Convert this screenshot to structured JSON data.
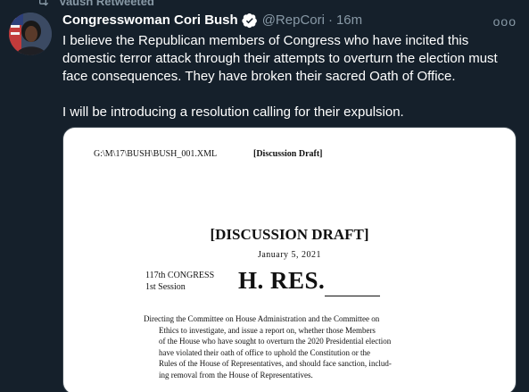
{
  "retweet": {
    "label": "Vaush Retweeted"
  },
  "author": {
    "display_name": "Congresswoman Cori Bush",
    "handle": "@RepCori",
    "separator": "·",
    "time": "16m"
  },
  "more_menu": {
    "label": "ooo"
  },
  "tweet": {
    "paragraph_1": "I believe the Republican members of Congress who have incited this domestic terror attack through their attempts to overturn the election must face consequences. They have broken their sacred Oath of Office.",
    "paragraph_2": "I will be introducing a resolution calling for their expulsion."
  },
  "document": {
    "path": "G:\\M\\17\\BUSH\\BUSH_001.XML",
    "draft_tag": "[Discussion Draft]",
    "title": "[DISCUSSION DRAFT]",
    "date": "January 5, 2021",
    "congress": "117th CONGRESS",
    "session": "1st Session",
    "bill": "H. RES.",
    "resolution_lines": [
      "Directing the Committee on House Administration and the Committee on",
      "Ethics to investigate, and issue a report on, whether those Members",
      "of the House who have sought to overturn the 2020 Presidential election",
      "have violated their oath of office to uphold the Constitution or the",
      "Rules of the House of Representatives, and should face sanction, includ-",
      "ing removal from the House of Representatives."
    ]
  },
  "colors": {
    "background": "#15202b",
    "secondary_text": "#8899a6",
    "verified_badge": "#ffffff"
  }
}
